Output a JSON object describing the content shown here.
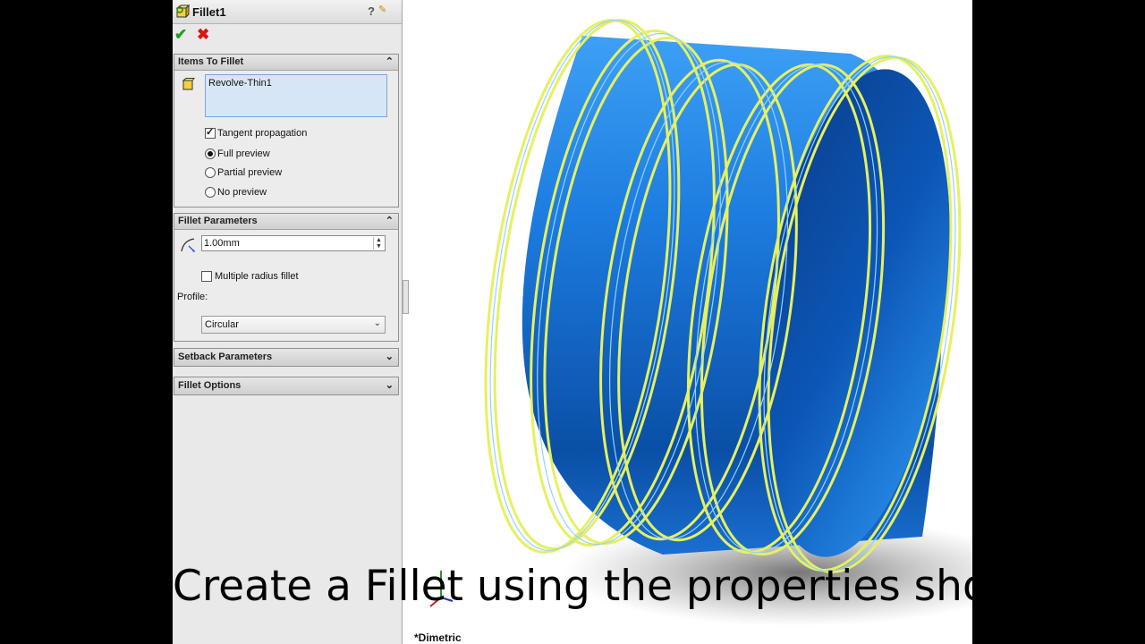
{
  "panel": {
    "title": "Fillet1",
    "help_icon": "?",
    "icons": {
      "feature": "fillet-feature-icon",
      "help": "help-icon",
      "pin": "pushpin-icon",
      "ok": "ok-check-icon",
      "cancel": "cancel-x-icon"
    }
  },
  "items_to_fillet": {
    "title": "Items To Fillet",
    "selection": "Revolve-Thin1",
    "tangent_propagation": {
      "label": "Tangent propagation",
      "checked": true
    },
    "preview_options": [
      {
        "label": "Full preview",
        "selected": true
      },
      {
        "label": "Partial preview",
        "selected": false
      },
      {
        "label": "No preview",
        "selected": false
      }
    ]
  },
  "fillet_parameters": {
    "title": "Fillet Parameters",
    "radius": "1.00mm",
    "multiple_radius": {
      "label": "Multiple radius fillet",
      "checked": false
    },
    "profile_label": "Profile:",
    "profile_value": "Circular"
  },
  "setback_parameters": {
    "title": "Setback Parameters"
  },
  "fillet_options": {
    "title": "Fillet Options"
  },
  "viewport": {
    "view_name": "*Dimetric",
    "model_color": "#1e7fe0",
    "edge_color": "#e6f060"
  },
  "caption": "Create a Fillet using the properties shown."
}
